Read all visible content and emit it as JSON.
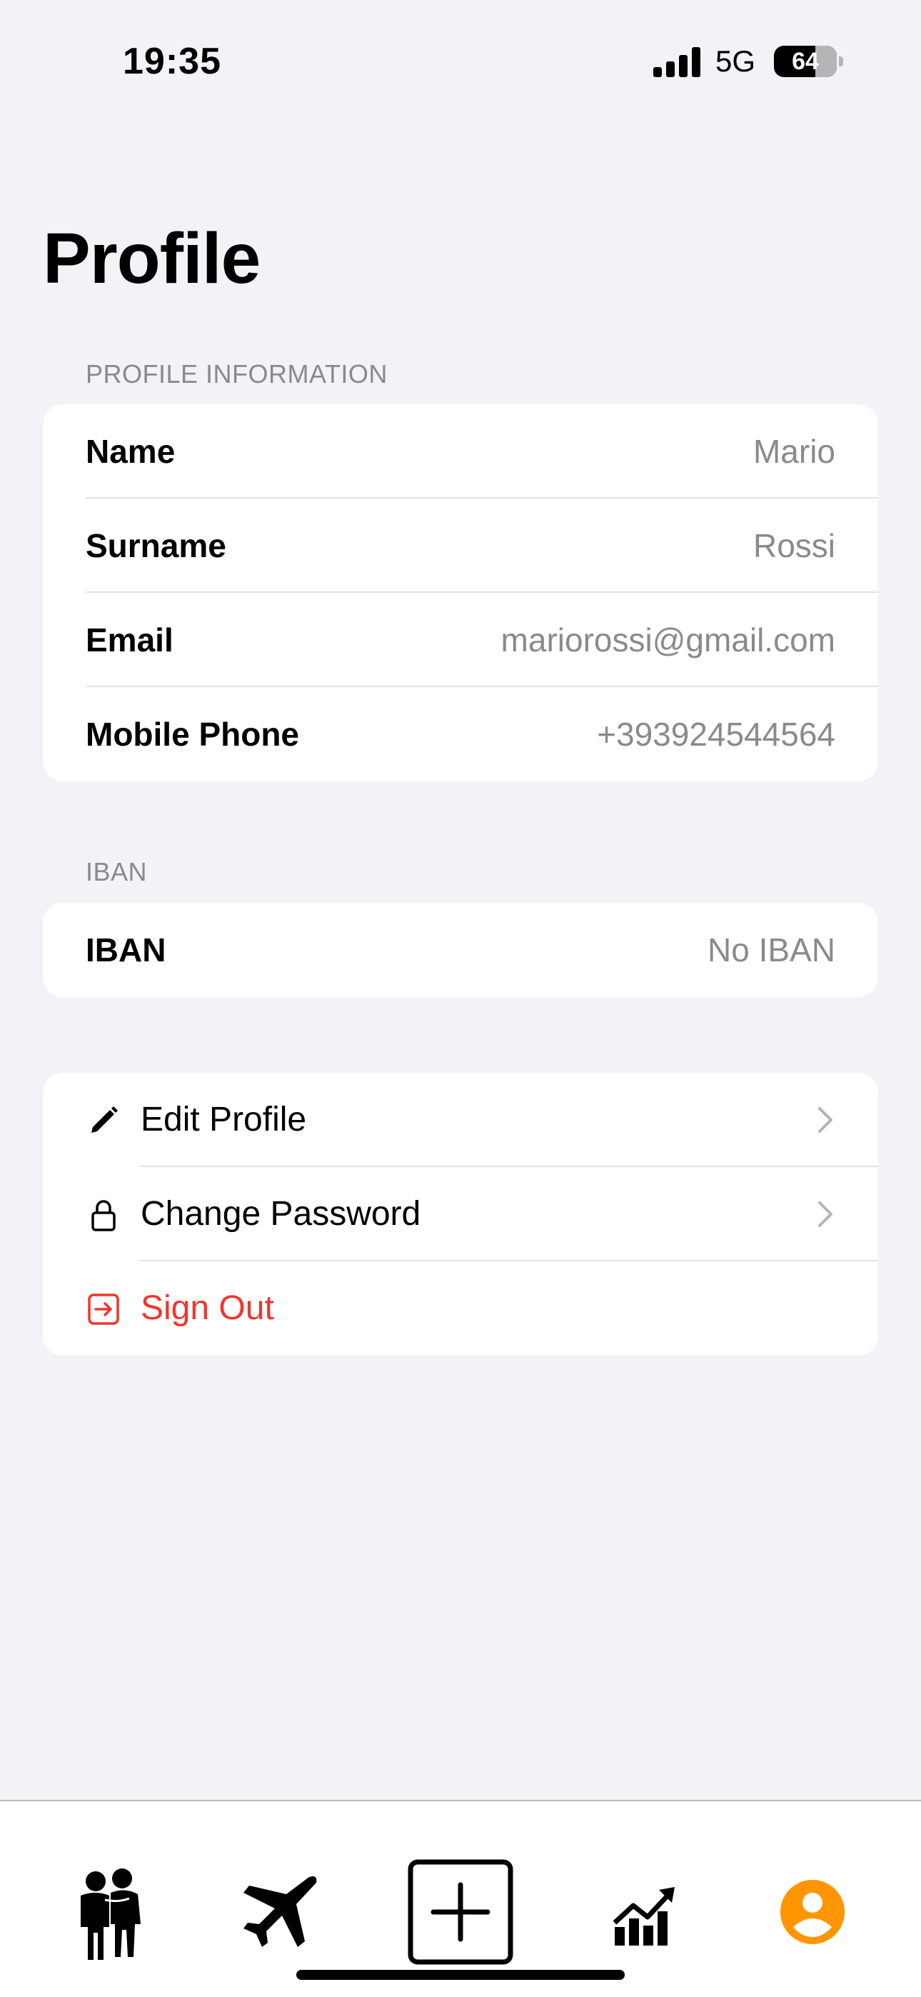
{
  "status_bar": {
    "time": "19:35",
    "network": "5G",
    "battery_level": "64"
  },
  "page": {
    "title": "Profile"
  },
  "profile_information": {
    "header": "PROFILE INFORMATION",
    "rows": [
      {
        "label": "Name",
        "value": "Mario"
      },
      {
        "label": "Surname",
        "value": "Rossi"
      },
      {
        "label": "Email",
        "value": "mariorossi@gmail.com"
      },
      {
        "label": "Mobile Phone",
        "value": "+393924544564"
      }
    ]
  },
  "iban": {
    "header": "IBAN",
    "label": "IBAN",
    "value": "No IBAN"
  },
  "actions": {
    "edit_profile": {
      "label": "Edit Profile",
      "icon": "pencil-icon"
    },
    "change_password": {
      "label": "Change Password",
      "icon": "lock-icon"
    },
    "sign_out": {
      "label": "Sign Out",
      "icon": "sign-out-icon"
    }
  },
  "tab_bar": {
    "tabs": [
      {
        "icon": "people-icon",
        "active": false
      },
      {
        "icon": "airplane-icon",
        "active": false
      },
      {
        "icon": "plus-square-icon",
        "active": false
      },
      {
        "icon": "chart-up-icon",
        "active": false
      },
      {
        "icon": "person-circle-icon",
        "active": true
      }
    ]
  },
  "colors": {
    "background": "#f2f2f7",
    "card": "#ffffff",
    "secondary_text": "#8a8a8e",
    "danger": "#f0352c",
    "accent": "#ff9500"
  }
}
